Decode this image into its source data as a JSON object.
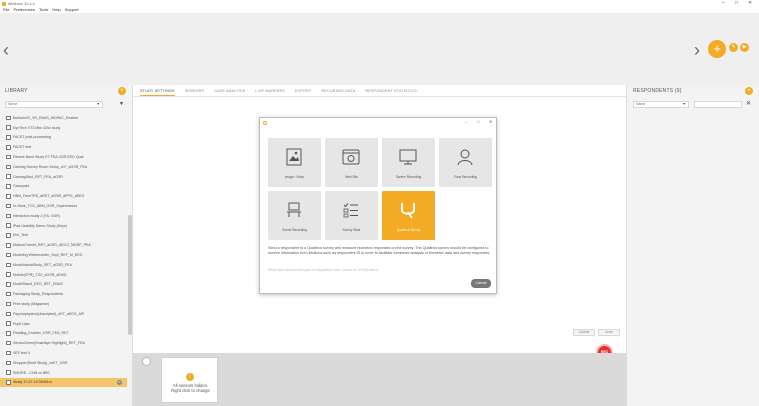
{
  "window": {
    "title": "iMotions 10.x.x",
    "controls": [
      "–",
      "□",
      "✕"
    ]
  },
  "menu": [
    "File",
    "Preferences",
    "Tools",
    "Help",
    "Support"
  ],
  "library": {
    "title": "LIBRARY",
    "sort_value": "Name",
    "studies": [
      "Bohlsen02_VR_ENAS_WDPAC_Enabler",
      "EyeTech VT3 Mini 42hz study",
      "FACET post-processing",
      "FACET test",
      "Fitness Band Study ET FEA GSR EEG Qual",
      "Gaming Survey Room Setup_v07_aGSR_FEA",
      "GamingStud_RET_FEA_aGSR",
      "Gazepoint",
      "HBM_FaceTRS_aRET_aGSR_aPPG_aEEG",
      "In-Store_TG2_ABM_GSR_Supermarket",
      "Interaction study 2 (FA, GSR)",
      "iPad Usability Demo Study (Keys)",
      "Kim_Test",
      "MarkusTrainer_RET_aGSR_AECG_MNSP_PEA",
      "Modeling Webrecorder_Sept_RET_M_EEG",
      "ModeltutoriaStudy_RET_aGSR_FEA",
      "Mobile(CPR)_TG2_aGSR_aEMG",
      "ModelStand_EEG_RET_ENAS",
      "Packaging Study_Respondents",
      "Print study (Magazine)",
      "Psychophysics(Unscripted)_eET_aEEG_API",
      "Pupil Labs",
      "Reading_Enabler_GSR_FEA_RET",
      "SensorDemo(Smartbye Highlight)_RET_FEA",
      "SEF test 4",
      "Shopper(Shelf Study)_ceET_GSR",
      "SMORE - CNN vs BBC",
      "Study 17-07-19 09h51m"
    ],
    "active_badge": "0"
  },
  "tabs": [
    "STUDY SETTINGS",
    "SENSORS",
    "GAZE ANALYSIS",
    "LIVE MARKERS",
    "EXPORT",
    "RECORDED DATA",
    "RESPONDENT STATISTICS"
  ],
  "main_buttons": {
    "update": "Update",
    "undo": "Undo"
  },
  "record_label": "REC",
  "sensors": {
    "hidden_message_line1": "All sensors hidden.",
    "hidden_message_line2": "Right click to change"
  },
  "respondents": {
    "title": "RESPONDENTS (9)",
    "sort_value": "Name",
    "search_value": "",
    "clear_icon": "✕"
  },
  "dialog": {
    "stimulus_types": [
      {
        "label": "Image / Video",
        "icon": "image-icon"
      },
      {
        "label": "Web Site",
        "icon": "web-site-icon"
      },
      {
        "label": "Screen Recording",
        "icon": "monitor-icon"
      },
      {
        "label": "Face Recording",
        "icon": "face-icon"
      },
      {
        "label": "Scene Recording",
        "icon": "scene-icon"
      },
      {
        "label": "Survey Slide",
        "icon": "survey-icon"
      },
      {
        "label": "Qualtrics Survey",
        "icon": "qualtrics-icon"
      }
    ],
    "selected": "Qualtrics Survey",
    "description": "Send a respondent to a Qualtrics survey and measure biometric responses on the survey. The Qualtrics survey should be configured to receive information from iMotions such as respondent ID in order to facilitate combined analysis of biometric data and survey responses.",
    "learn_more": "Read more about these types of integrations here: search for 'API/Qualtrics'",
    "cancel_label": "Cancel"
  },
  "colors": {
    "accent": "#f3ab25",
    "record": "#e8302c",
    "active_row": "#f5c46a"
  }
}
